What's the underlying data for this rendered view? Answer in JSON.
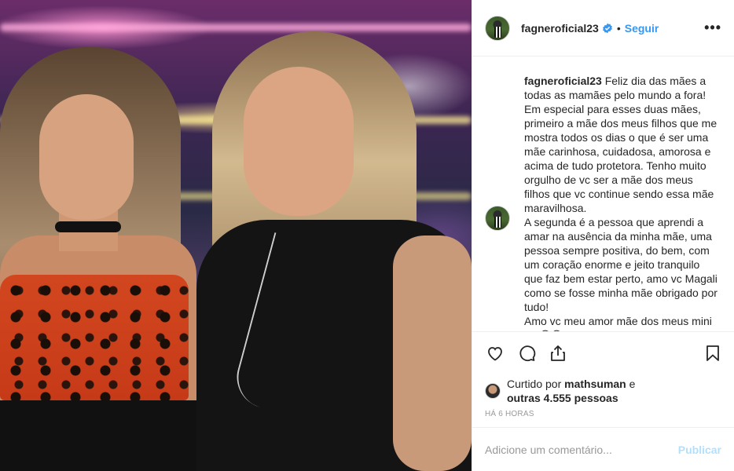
{
  "post": {
    "username": "fagneroficial23",
    "separator": "•",
    "follow_label": "Seguir",
    "options_icon_text": "•••",
    "caption_username": "fagneroficial23",
    "caption": "Feliz dia das mães a todas as mamães pelo mundo a fora! Em especial para esses duas mães, primeiro a mãe dos meus filhos que me mostra todos os dias o que é ser uma mãe carinhosa, cuidadosa, amorosa e acima de tudo protetora. Tenho muito orgulho de vc ser a mãe dos meus filhos que vc continue sendo essa mãe maravilhosa.\nA segunda é a pessoa que aprendi a amar na ausência da minha mãe, uma pessoa sempre positiva, do bem, com um coração enorme e jeito tranquilo que faz bem estar perto, amo vc Magali como se fosse minha mãe obrigado por tudo!\nAmo vc meu amor mãe dos meus mini eu 😍😊",
    "likes_prefix": "Curtido por",
    "likes_user": "mathsuman",
    "likes_and": "e",
    "likes_others": "outras 4.555 pessoas",
    "timestamp": "Há 6 horas",
    "comment_placeholder": "Adicione um comentário...",
    "publish_label": "Publicar"
  },
  "colors": {
    "link_blue": "#3897f0",
    "publish_disabled": "#b2dffc",
    "verified_blue": "#3897f0",
    "meta_gray": "#999999"
  },
  "icons": [
    "verified-badge-icon",
    "heart-icon",
    "comment-icon",
    "share-icon",
    "bookmark-icon",
    "more-options-icon"
  ]
}
